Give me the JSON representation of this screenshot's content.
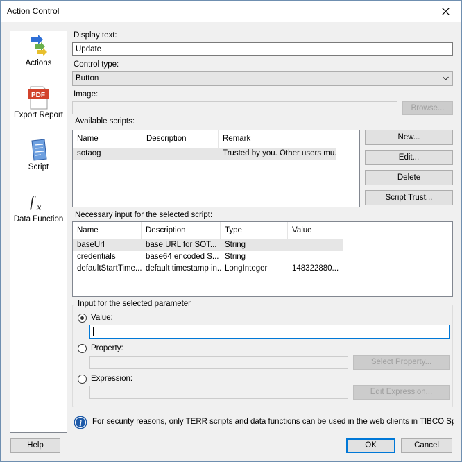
{
  "window": {
    "title": "Action Control"
  },
  "sidebar": {
    "items": [
      {
        "label": "Actions",
        "icon": "actions-arrows-icon"
      },
      {
        "label": "Export Report",
        "icon": "pdf-icon"
      },
      {
        "label": "Script",
        "icon": "script-icon"
      },
      {
        "label": "Data Function",
        "icon": "fx-icon"
      }
    ],
    "selected": "Script"
  },
  "form": {
    "display_text_label": "Display text:",
    "display_text_value": "Update",
    "control_type_label": "Control type:",
    "control_type_value": "Button",
    "image_label": "Image:",
    "image_value": "",
    "browse_label": "Browse...",
    "available_scripts_label": "Available scripts:"
  },
  "scripts_table": {
    "headers": [
      "Name",
      "Description",
      "Remark"
    ],
    "rows": [
      {
        "name": "sotaog",
        "description": "",
        "remark": "Trusted by you. Other users mu..."
      }
    ]
  },
  "script_buttons": {
    "new": "New...",
    "edit": "Edit...",
    "delete": "Delete",
    "trust": "Script Trust..."
  },
  "inputs_table": {
    "label": "Necessary input for the selected script:",
    "headers": [
      "Name",
      "Description",
      "Type",
      "Value"
    ],
    "rows": [
      {
        "name": "baseUrl",
        "description": "base URL for SOT...",
        "type": "String",
        "value": ""
      },
      {
        "name": "credentials",
        "description": "base64 encoded S...",
        "type": "String",
        "value": ""
      },
      {
        "name": "defaultStartTime...",
        "description": "default timestamp in...",
        "type": "LongInteger",
        "value": "148322880..."
      }
    ]
  },
  "parameter": {
    "group_label": "Input for the selected parameter",
    "value_label": "Value:",
    "value_input": "",
    "property_label": "Property:",
    "property_input": "",
    "select_property_label": "Select Property...",
    "expression_label": "Expression:",
    "expression_input": "",
    "edit_expression_label": "Edit Expression...",
    "selected": "value"
  },
  "notice": "For security reasons, only TERR scripts and data functions can be used in the web clients in TIBCO Spotfire Cl",
  "footer": {
    "help": "Help",
    "ok": "OK",
    "cancel": "Cancel"
  },
  "colors": {
    "accent": "#0078d7",
    "selection": "#e5f3ff",
    "info_icon": "#1e5aa8"
  }
}
